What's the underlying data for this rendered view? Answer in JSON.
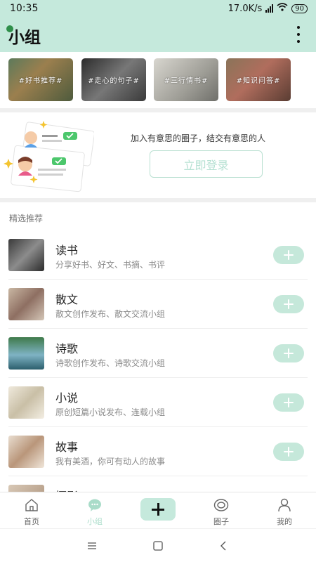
{
  "status": {
    "time": "10:35",
    "speed": "17.0K/s",
    "battery": "90"
  },
  "header": {
    "title": "小组"
  },
  "tags": [
    {
      "label": "#好书推荐#"
    },
    {
      "label": "#走心的句子#"
    },
    {
      "label": "#三行情书#"
    },
    {
      "label": "#知识问答#"
    }
  ],
  "promo": {
    "text": "加入有意思的圈子，结交有意思的人",
    "button": "立即登录"
  },
  "section": {
    "title": "精选推荐"
  },
  "groups": [
    {
      "name": "读书",
      "desc": "分享好书、好文、书摘、书评"
    },
    {
      "name": "散文",
      "desc": "散文创作发布、散文交流小组"
    },
    {
      "name": "诗歌",
      "desc": "诗歌创作发布、诗歌交流小组"
    },
    {
      "name": "小说",
      "desc": "原创短篇小说发布、连载小组"
    },
    {
      "name": "故事",
      "desc": "我有美酒，你可有动人的故事"
    },
    {
      "name": "摄影",
      "desc": ""
    }
  ],
  "tabs": [
    {
      "label": "首页",
      "icon": "home-icon"
    },
    {
      "label": "小组",
      "icon": "chat-bubble-icon"
    },
    {
      "label": "圈子",
      "icon": "circle-icon"
    },
    {
      "label": "我的",
      "icon": "person-icon"
    }
  ],
  "colors": {
    "accent": "#c5e9dc",
    "accent_text": "#a9dcc9"
  }
}
